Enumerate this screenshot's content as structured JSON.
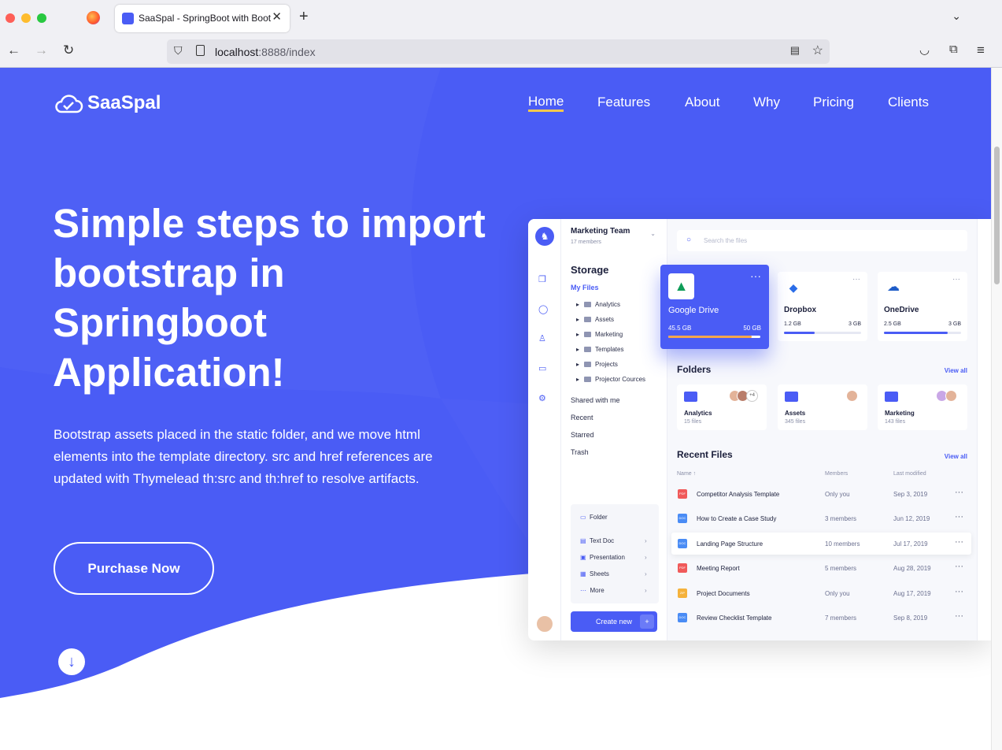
{
  "browser": {
    "tab_title": "SaaSpal - SpringBoot with Boots",
    "url_host": "localhost",
    "url_rest": ":8888/index"
  },
  "site": {
    "logo": "SaaSpal",
    "nav": [
      "Home",
      "Features",
      "About",
      "Why",
      "Pricing",
      "Clients"
    ],
    "hero_title": "Simple steps to import bootstrap in Springboot Application!",
    "hero_text": "Bootstrap assets placed in the static folder, and we move html elements into the template directory. src and href references are updated with Thymelead th:src and th:href to resolve artifacts.",
    "cta": "Purchase Now",
    "colors": {
      "primary": "#4a5cf5",
      "accent": "#f5c84c"
    }
  },
  "dashboard": {
    "team": "Marketing Team",
    "members": "17 members",
    "storage_title": "Storage",
    "my_files": "My Files",
    "folders_tree": [
      "Analytics",
      "Assets",
      "Marketing",
      "Templates",
      "Projects",
      "Projector Cources"
    ],
    "side_links": [
      "Shared with me",
      "Recent",
      "Starred",
      "Trash"
    ],
    "create_menu": [
      "Folder",
      "Text Doc",
      "Presentation",
      "Sheets",
      "More"
    ],
    "create_button": "Create new",
    "search_placeholder": "Search the files",
    "clouds": [
      {
        "name": "Google Drive",
        "used": "45.5 GB",
        "total": "50 GB",
        "fraction": 0.91
      },
      {
        "name": "Dropbox",
        "used": "1.2 GB",
        "total": "3 GB",
        "fraction": 0.4
      },
      {
        "name": "OneDrive",
        "used": "2.5 GB",
        "total": "3 GB",
        "fraction": 0.83
      }
    ],
    "folders_title": "Folders",
    "view_all": "View all",
    "folders": [
      {
        "name": "Analytics",
        "count": "15 files",
        "extra": "+4"
      },
      {
        "name": "Assets",
        "count": "345 files"
      },
      {
        "name": "Marketing",
        "count": "143 files"
      }
    ],
    "recent_title": "Recent Files",
    "columns": {
      "name": "Name",
      "members": "Members",
      "modified": "Last modified"
    },
    "files": [
      {
        "name": "Competitor Analysis Template",
        "members": "Only you",
        "date": "Sep 3, 2019",
        "type": "PDF",
        "color": "#f05a5a"
      },
      {
        "name": "How to Create a Case Study",
        "members": "3 members",
        "date": "Jun 12, 2019",
        "type": "DOC",
        "color": "#4a8cf5"
      },
      {
        "name": "Landing Page Structure",
        "members": "10 members",
        "date": "Jul 17, 2019",
        "type": "DOC",
        "color": "#4a8cf5"
      },
      {
        "name": "Meeting Report",
        "members": "5 members",
        "date": "Aug 28, 2019",
        "type": "PDF",
        "color": "#f05a5a"
      },
      {
        "name": "Project Documents",
        "members": "Only you",
        "date": "Aug 17, 2019",
        "type": "ZIP",
        "color": "#f5b23c"
      },
      {
        "name": "Review Checklist Template",
        "members": "7 members",
        "date": "Sep 8, 2019",
        "type": "DOC",
        "color": "#4a8cf5"
      }
    ]
  }
}
